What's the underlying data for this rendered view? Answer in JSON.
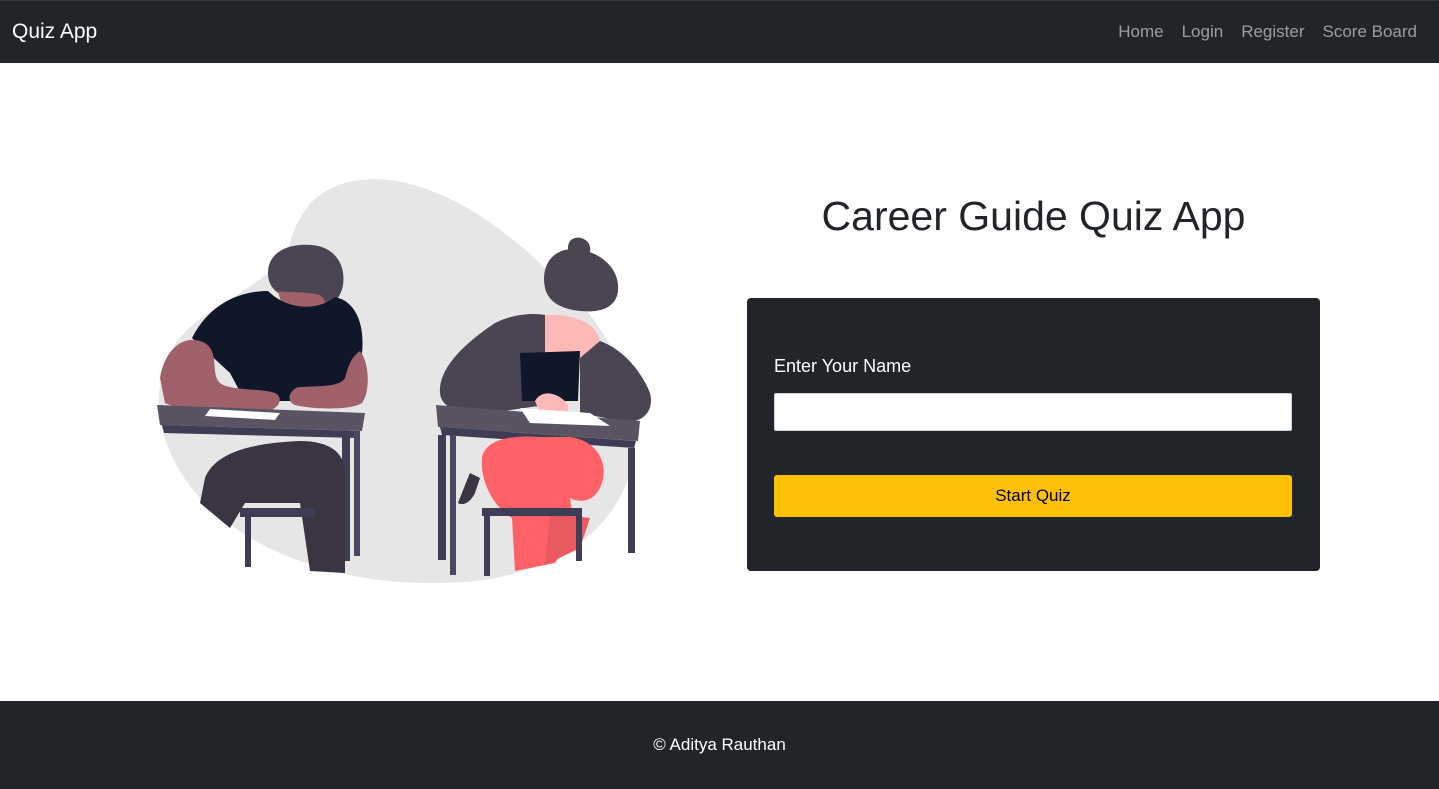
{
  "navbar": {
    "brand": "Quiz App",
    "links": [
      {
        "label": "Home"
      },
      {
        "label": "Login"
      },
      {
        "label": "Register"
      },
      {
        "label": "Score Board"
      }
    ]
  },
  "hero": {
    "title": "Career Guide Quiz App"
  },
  "form": {
    "name_label": "Enter Your Name",
    "name_value": "",
    "start_label": "Start Quiz"
  },
  "footer": {
    "text": "© Aditya Rauthan"
  },
  "colors": {
    "dark": "#212529",
    "accent": "#ffc107",
    "blob": "#e6e6e6",
    "skin": "#a0616a",
    "hair": "#4a4453",
    "pants": "#ff6166",
    "shirt": "#0f1729"
  }
}
